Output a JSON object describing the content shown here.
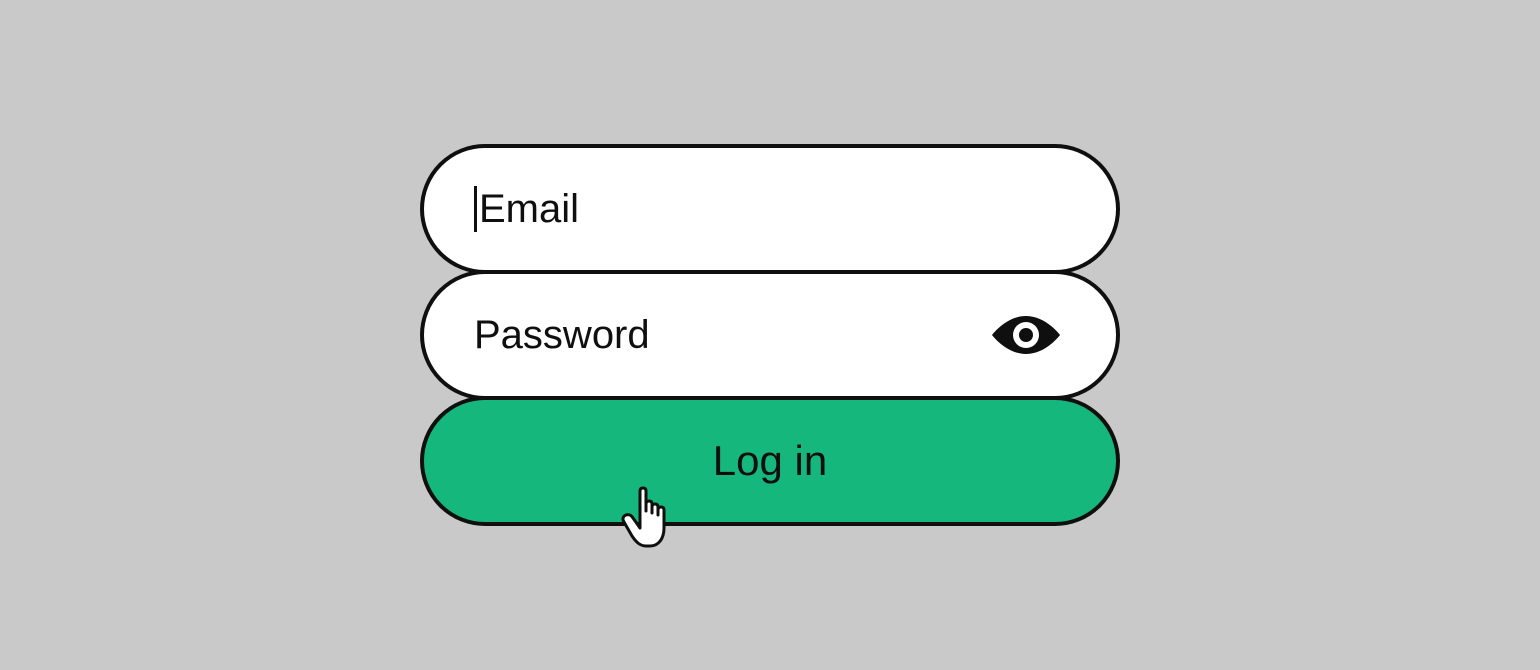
{
  "form": {
    "email": {
      "placeholder": "Email",
      "value": ""
    },
    "password": {
      "placeholder": "Password",
      "value": ""
    },
    "login_label": "Log in"
  },
  "colors": {
    "accent": "#15b77c",
    "background": "#c9c9c9",
    "stroke": "#0f0f0f",
    "field_bg": "#ffffff"
  },
  "icons": {
    "eye": "eye-icon",
    "cursor": "pointer-cursor-icon"
  }
}
